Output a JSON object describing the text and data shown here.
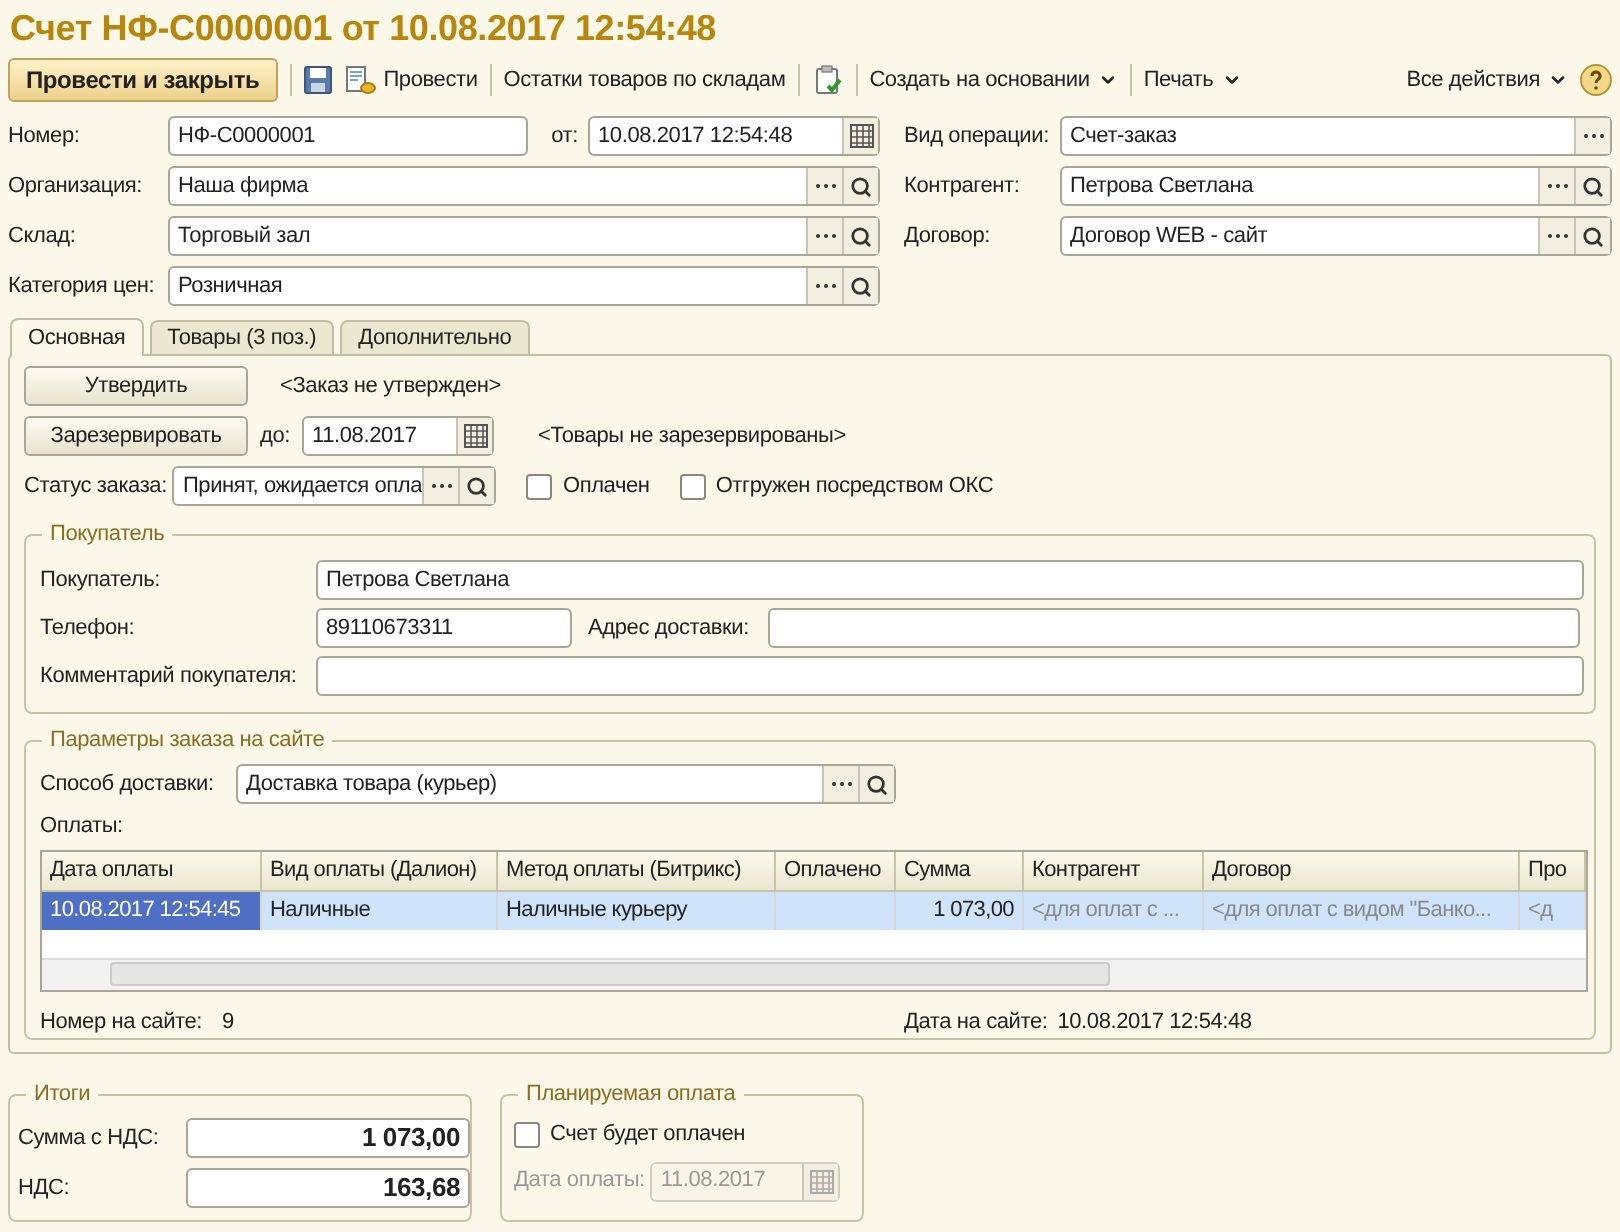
{
  "window": {
    "title": "Счет НФ-С0000001 от 10.08.2017 12:54:48"
  },
  "toolbar": [
    {
      "kind": "primary",
      "label": "Провести и закрыть"
    },
    {
      "kind": "save"
    },
    {
      "kind": "post",
      "label": "Провести"
    },
    {
      "kind": "text",
      "label": "Остатки товаров по складам"
    },
    {
      "kind": "check"
    },
    {
      "kind": "menu",
      "label": "Создать на основании"
    },
    {
      "kind": "menu",
      "label": "Печать"
    }
  ],
  "all_actions": "Все действия",
  "header": {
    "number": {
      "label": "Номер:",
      "value": "НФ-С0000001"
    },
    "date": {
      "label": "от:",
      "value": "10.08.2017 12:54:48"
    },
    "left": [
      {
        "label": "Организация:",
        "value": "Наша фирма"
      },
      {
        "label": "Склад:",
        "value": "Торговый зал"
      },
      {
        "label": "Категория цен:",
        "value": "Розничная"
      }
    ],
    "right": [
      {
        "label": "Вид операции:",
        "value": "Счет-заказ",
        "search": false
      },
      {
        "label": "Контрагент:",
        "value": "Петрова Светлана",
        "search": true
      },
      {
        "label": "Договор:",
        "value": "Договор WEB - сайт",
        "search": true
      }
    ]
  },
  "tabs": [
    {
      "label": "Основная",
      "selected": true
    },
    {
      "label": "Товары (3 поз.)",
      "selected": false
    },
    {
      "label": "Дополнительно",
      "selected": false
    }
  ],
  "main": {
    "approve_button": "Утвердить",
    "approve_status": "<Заказ не утвержден>",
    "reserve_button": "Зарезервировать",
    "reserve_until": {
      "label": "до:",
      "value": "11.08.2017"
    },
    "reserve_status": "<Товары не зарезервированы>",
    "order_status": {
      "label": "Статус заказа:",
      "value": "Принят, ожидается опла"
    },
    "checkboxes": [
      {
        "label": "Оплачен",
        "checked": false
      },
      {
        "label": "Отгружен посредством ОКС",
        "checked": false
      }
    ]
  },
  "buyer": {
    "title": "Покупатель",
    "name": {
      "label": "Покупатель:",
      "value": "Петрова Светлана"
    },
    "phone": {
      "label": "Телефон:",
      "value": "89110673311"
    },
    "address": {
      "label": "Адрес доставки:"
    },
    "comment": {
      "label": "Комментарий покупателя:"
    }
  },
  "site": {
    "title": "Параметры заказа на сайте",
    "delivery": {
      "label": "Способ доставки:",
      "value": "Доставка товара (курьер)"
    },
    "payments_label": "Оплаты:",
    "columns": [
      "Дата оплаты",
      "Вид оплаты (Далион)",
      "Метод оплаты (Битрикс)",
      "Оплачено",
      "Сумма",
      "Контрагент",
      "Договор",
      "Про"
    ],
    "rows": [
      {
        "selected": true,
        "cells": [
          "10.08.2017 12:54:45",
          "Наличные",
          "Наличные курьеру",
          "",
          "1 073,00",
          "<для оплат с ...",
          "<для оплат с видом \"Банко...",
          "<д"
        ]
      }
    ],
    "site_number": {
      "label": "Номер на сайте:",
      "value": "9"
    },
    "site_date": {
      "label": "Дата на сайте:",
      "value": "10.08.2017 12:54:48"
    }
  },
  "totals": {
    "title": "Итоги",
    "rows": [
      {
        "label": "Сумма с НДС:",
        "value": "1 073,00"
      },
      {
        "label": "НДС:",
        "value": "163,68"
      }
    ]
  },
  "planned": {
    "title": "Планируемая оплата",
    "checkbox": {
      "label": "Счет будет оплачен",
      "checked": false
    },
    "date": {
      "label": "Дата оплаты:",
      "value": "11.08.2017",
      "disabled": true
    }
  }
}
